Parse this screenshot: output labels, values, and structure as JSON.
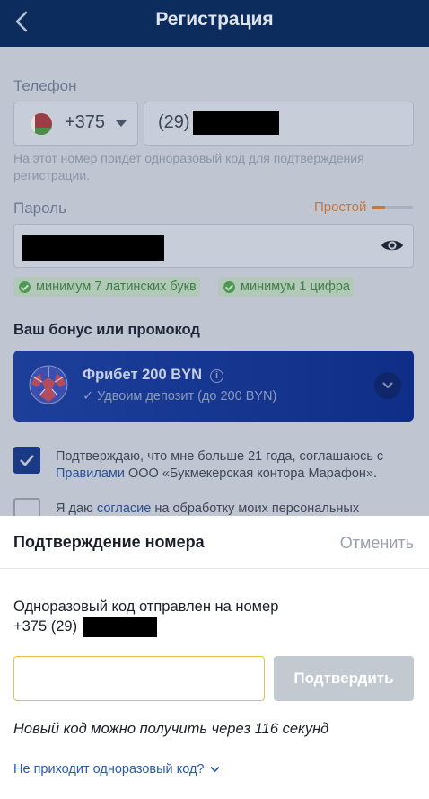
{
  "header": {
    "title": "Регистрация",
    "back_icon": "chevron-left-icon"
  },
  "form": {
    "phone": {
      "label": "Телефон",
      "country_code": "+375",
      "country_flag": "belarus-flag-icon",
      "prefix": "(29)",
      "hint": "На этот номер придет одноразовый код для подтверждения регистрации."
    },
    "password": {
      "label": "Пароль",
      "strength_label": "Простой",
      "strength_level": 0.33,
      "visibility_icon": "eye-icon"
    },
    "requirements": [
      {
        "text": "минимум 7 латинских букв",
        "met": true
      },
      {
        "text": "минимум 1 цифра",
        "met": true
      }
    ],
    "bonus_section": {
      "title": "Ваш бонус или промокод",
      "card_title": "Фрибет 200 BYN",
      "card_subtitle": "✓ Удвоим депозит (до 200 BYN)",
      "card_icon": "football-ball-icon"
    },
    "consent": {
      "age_text_before": "Подтверждаю, что мне больше 21 года, соглашаюсь с",
      "age_link": "Правилами",
      "age_text_after": "ООО «Букмекерская контора Марафон».",
      "age_checked": true,
      "data_text_before": "Я даю",
      "data_link": "согласие",
      "data_text_after": "на обработку моих персональных",
      "data_checked": false
    }
  },
  "sheet": {
    "title": "Подтверждение номера",
    "cancel_label": "Отменить",
    "sent_line1": "Одноразовый код отправлен на номер",
    "sent_prefix": "+375 (29)",
    "code_value": "",
    "confirm_label": "Подтвердить",
    "resend_text": "Новый код можно получить через 116 секунд",
    "no_code_link": "Не приходит одноразовый код?"
  },
  "colors": {
    "header_bg": "#0c2c5e",
    "accent_blue": "#1a3a86",
    "success_green": "#4a9a52",
    "weak_orange": "#c9753a",
    "input_focus": "#e6c14b"
  }
}
